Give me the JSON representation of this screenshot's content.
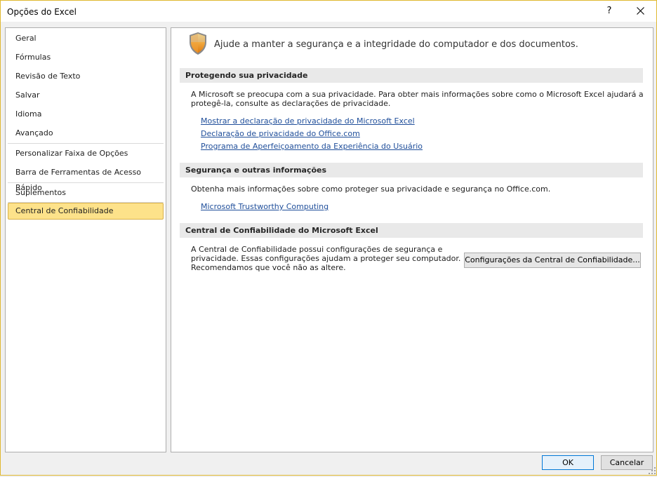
{
  "window": {
    "title": "Opções do Excel",
    "help": "?",
    "border_color": "#e0b830"
  },
  "nav": {
    "items": [
      {
        "label": "Geral"
      },
      {
        "label": "Fórmulas"
      },
      {
        "label": "Revisão de Texto"
      },
      {
        "label": "Salvar"
      },
      {
        "label": "Idioma"
      },
      {
        "label": "Avançado"
      },
      {
        "label": "Personalizar Faixa de Opções"
      },
      {
        "label": "Barra de Ferramentas de Acesso Rápido"
      },
      {
        "label": "Suplementos"
      },
      {
        "label": "Central de Confiabilidade",
        "selected": true
      }
    ],
    "selected_color": "#fde28a"
  },
  "main": {
    "header": "Ajude a manter a segurança e a integridade do computador e dos documentos.",
    "sections": [
      {
        "title": "Protegendo sua privacidade",
        "text_line1": "A Microsoft se preocupa com a sua privacidade. Para obter mais informações sobre como o Microsoft Excel ajudará a",
        "text_line2": "protegê-la, consulte as declarações de privacidade.",
        "links": [
          "Mostrar a declaração de privacidade do Microsoft Excel",
          "Declaração de privacidade do Office.com",
          "Programa de Aperfeiçoamento da Experiência do Usuário"
        ]
      },
      {
        "title": "Segurança e outras informações",
        "text": "Obtenha mais informações sobre como proteger sua privacidade e segurança no Office.com.",
        "links": [
          "Microsoft Trustworthy Computing"
        ]
      },
      {
        "title": "Central de Confiabilidade do Microsoft Excel",
        "text_line1": "A Central de Confiabilidade possui configurações de segurança e",
        "text_line2": "privacidade. Essas configurações ajudam a proteger seu computador.",
        "text_line3": "Recomendamos que você não as altere.",
        "button": "Configurações da Central de Confiabilidade..."
      }
    ],
    "link_color": "#1f4e9a"
  },
  "footer": {
    "ok": "OK",
    "cancel": "Cancelar"
  },
  "icons": {
    "header": "shield-icon",
    "close": "close-icon",
    "help": "help-icon",
    "resize": "resize-grip-icon"
  }
}
